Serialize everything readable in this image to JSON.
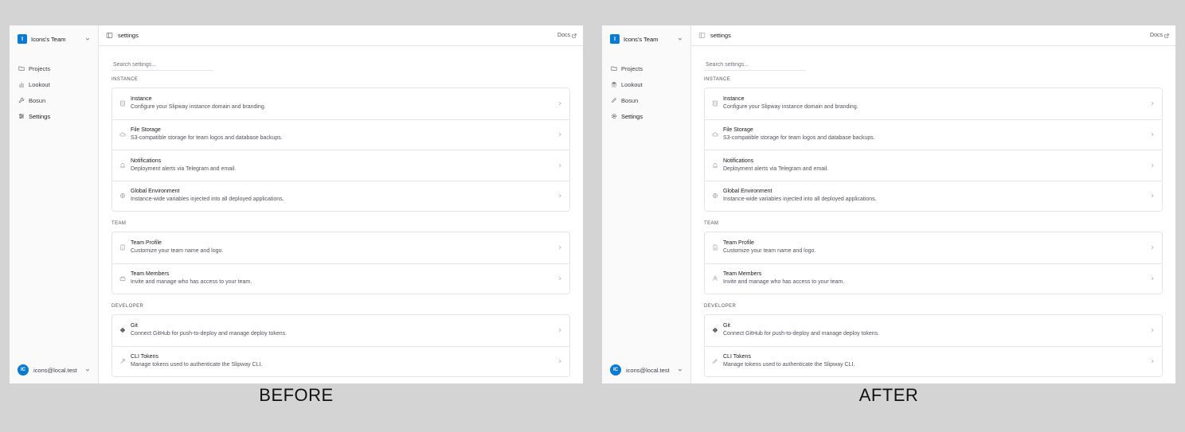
{
  "captions": {
    "before": "BEFORE",
    "after": "AFTER"
  },
  "colors": {
    "accent": "#0b7bd1",
    "border": "#e4e4e7",
    "sidebar_bg": "#fafafa",
    "backdrop": "#d4d4d4"
  },
  "before": {
    "team": {
      "logo_letter": "I",
      "name": "Icons's Team"
    },
    "nav": [
      {
        "label": "Projects",
        "icon": "folder-icon"
      },
      {
        "label": "Lookout",
        "icon": "bar-chart-icon"
      },
      {
        "label": "Bosun",
        "icon": "wrench-icon"
      },
      {
        "label": "Settings",
        "icon": "sliders-icon"
      }
    ],
    "user": {
      "initials": "IC",
      "email": "icons@local.test"
    },
    "topbar": {
      "crumb": "settings",
      "docs": "Docs"
    },
    "search_placeholder": "Search settings...",
    "sections": {
      "instance": {
        "label": "INSTANCE",
        "rows": [
          {
            "title": "Instance",
            "desc": "Configure your Slipway instance domain and branding.",
            "icon": "server-icon"
          },
          {
            "title": "File Storage",
            "desc": "S3-compatible storage for team logos and database backups.",
            "icon": "cloud-icon"
          },
          {
            "title": "Notifications",
            "desc": "Deployment alerts via Telegram and email.",
            "icon": "bell-icon"
          },
          {
            "title": "Global Environment",
            "desc": "Instance-wide variables injected into all deployed applications.",
            "icon": "globe-icon"
          }
        ]
      },
      "team": {
        "label": "TEAM",
        "rows": [
          {
            "title": "Team Profile",
            "desc": "Customize your team name and logo.",
            "icon": "id-card-icon"
          },
          {
            "title": "Team Members",
            "desc": "Invite and manage who has access to your team.",
            "icon": "users-icon"
          }
        ]
      },
      "developer": {
        "label": "DEVELOPER",
        "rows": [
          {
            "title": "Git",
            "desc": "Connect GitHub for push-to-deploy and manage deploy tokens.",
            "icon": "git-icon"
          },
          {
            "title": "CLI Tokens",
            "desc": "Manage tokens used to authenticate the Slipway CLI.",
            "icon": "key-icon"
          }
        ]
      }
    }
  },
  "after": {
    "team": {
      "logo_letter": "I",
      "name": "Icons's Team"
    },
    "nav": [
      {
        "label": "Projects",
        "icon": "folder-icon"
      },
      {
        "label": "Lookout",
        "icon": "landmark-icon"
      },
      {
        "label": "Bosun",
        "icon": "pen-icon"
      },
      {
        "label": "Settings",
        "icon": "gear-icon"
      }
    ],
    "user": {
      "initials": "IC",
      "email": "icons@local.test"
    },
    "topbar": {
      "crumb": "settings",
      "docs": "Docs"
    },
    "search_placeholder": "Search settings...",
    "sections": {
      "instance": {
        "label": "INSTANCE",
        "rows": [
          {
            "title": "Instance",
            "desc": "Configure your Slipway instance domain and branding.",
            "icon": "server-icon"
          },
          {
            "title": "File Storage",
            "desc": "S3-compatible storage for team logos and database backups.",
            "icon": "cloud-icon"
          },
          {
            "title": "Notifications",
            "desc": "Deployment alerts via Telegram and email.",
            "icon": "bell-icon"
          },
          {
            "title": "Global Environment",
            "desc": "Instance-wide variables injected into all deployed applications.",
            "icon": "globe-icon"
          }
        ]
      },
      "team": {
        "label": "TEAM",
        "rows": [
          {
            "title": "Team Profile",
            "desc": "Customize your team name and logo.",
            "icon": "document-icon"
          },
          {
            "title": "Team Members",
            "desc": "Invite and manage who has access to your team.",
            "icon": "user-icon"
          }
        ]
      },
      "developer": {
        "label": "DEVELOPER",
        "rows": [
          {
            "title": "Git",
            "desc": "Connect GitHub for push-to-deploy and manage deploy tokens.",
            "icon": "git-icon"
          },
          {
            "title": "CLI Tokens",
            "desc": "Manage tokens used to authenticate the Slipway CLI.",
            "icon": "pencil-icon"
          }
        ]
      }
    }
  }
}
